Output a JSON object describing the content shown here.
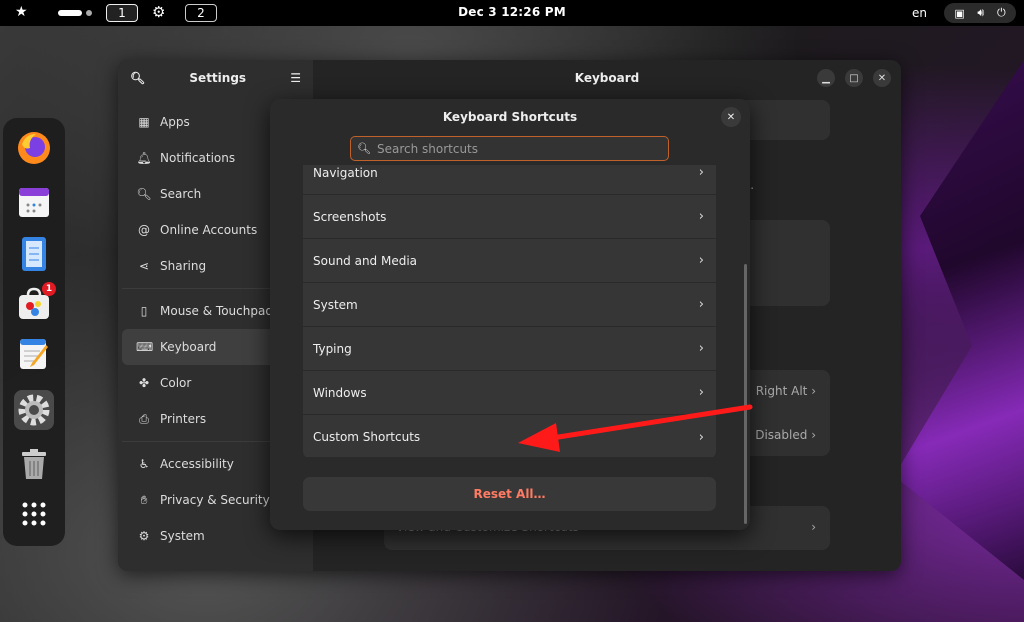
{
  "topbar": {
    "workspace_1": "1",
    "workspace_2": "2",
    "clock": "Dec 3  12:26 PM",
    "language": "en"
  },
  "dock": {
    "badge_count": "1",
    "items": [
      "firefox",
      "calendar",
      "text-editor-notes",
      "software-store",
      "text-editor",
      "settings",
      "trash",
      "app-grid"
    ]
  },
  "settings": {
    "sidebar_title": "Settings",
    "main_title": "Keyboard",
    "sidebar_items": [
      {
        "label": "Apps",
        "icon": "apps-icon"
      },
      {
        "label": "Notifications",
        "icon": "bell-icon"
      },
      {
        "label": "Search",
        "icon": "search-icon"
      },
      {
        "label": "Online Accounts",
        "icon": "at-icon"
      },
      {
        "label": "Sharing",
        "icon": "share-icon"
      },
      {
        "label": "Mouse & Touchpad",
        "icon": "mouse-icon"
      },
      {
        "label": "Keyboard",
        "icon": "keyboard-icon"
      },
      {
        "label": "Color",
        "icon": "palette-icon"
      },
      {
        "label": "Printers",
        "icon": "printer-icon"
      },
      {
        "label": "Accessibility",
        "icon": "accessibility-icon"
      },
      {
        "label": "Privacy & Security",
        "icon": "hand-icon"
      },
      {
        "label": "System",
        "icon": "gear-icon"
      }
    ],
    "background": {
      "partial_text": "ut.",
      "right_alt": "Right Alt",
      "disabled": "Disabled",
      "view_shortcuts": "View and Customize Shortcuts"
    }
  },
  "dialog": {
    "title": "Keyboard Shortcuts",
    "search_placeholder": "Search shortcuts",
    "rows": [
      "Navigation",
      "Screenshots",
      "Sound and Media",
      "System",
      "Typing",
      "Windows",
      "Custom Shortcuts"
    ],
    "reset_label": "Reset All…"
  },
  "colors": {
    "accent_border": "#c0602a",
    "destructive_text": "#ff7b63",
    "annotation_arrow": "#ff1a1a"
  }
}
